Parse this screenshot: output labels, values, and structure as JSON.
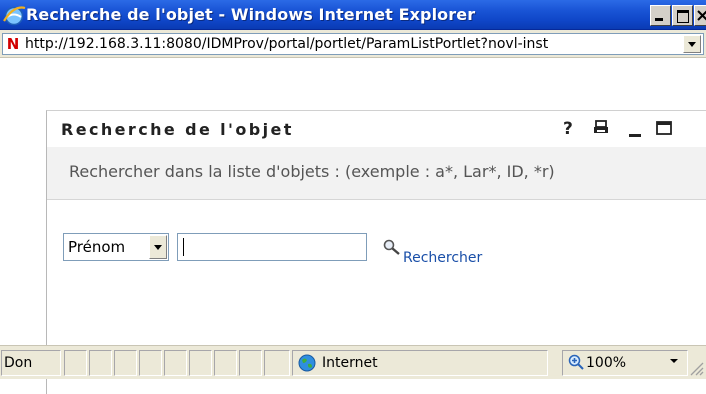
{
  "window": {
    "title": "Recherche de l'objet - Windows Internet Explorer"
  },
  "address_bar": {
    "url": "http://192.168.3.11:8080/IDMProv/portal/portlet/ParamListPortlet?novl-inst"
  },
  "portlet": {
    "title": "Recherche de l'objet",
    "help_label": "?",
    "description": "Rechercher dans la liste d'objets : (exemple : a*, Lar*, ID, *r)",
    "search_field": {
      "selected_attribute": "Prénom",
      "value": ""
    },
    "search_button_label": "Rechercher"
  },
  "status_bar": {
    "status_text": "Don",
    "zone": "Internet",
    "zoom": "100%"
  },
  "colors": {
    "title_bar": "#1a55d6",
    "link": "#1a4fa8",
    "description_band": "#f2f2f2",
    "chrome": "#ece9d8"
  },
  "icons": [
    "ie-icon",
    "novell-icon",
    "help-icon",
    "print-icon",
    "minimize-icon",
    "maximize-icon",
    "search-icon",
    "globe-icon",
    "zoom-icon"
  ]
}
